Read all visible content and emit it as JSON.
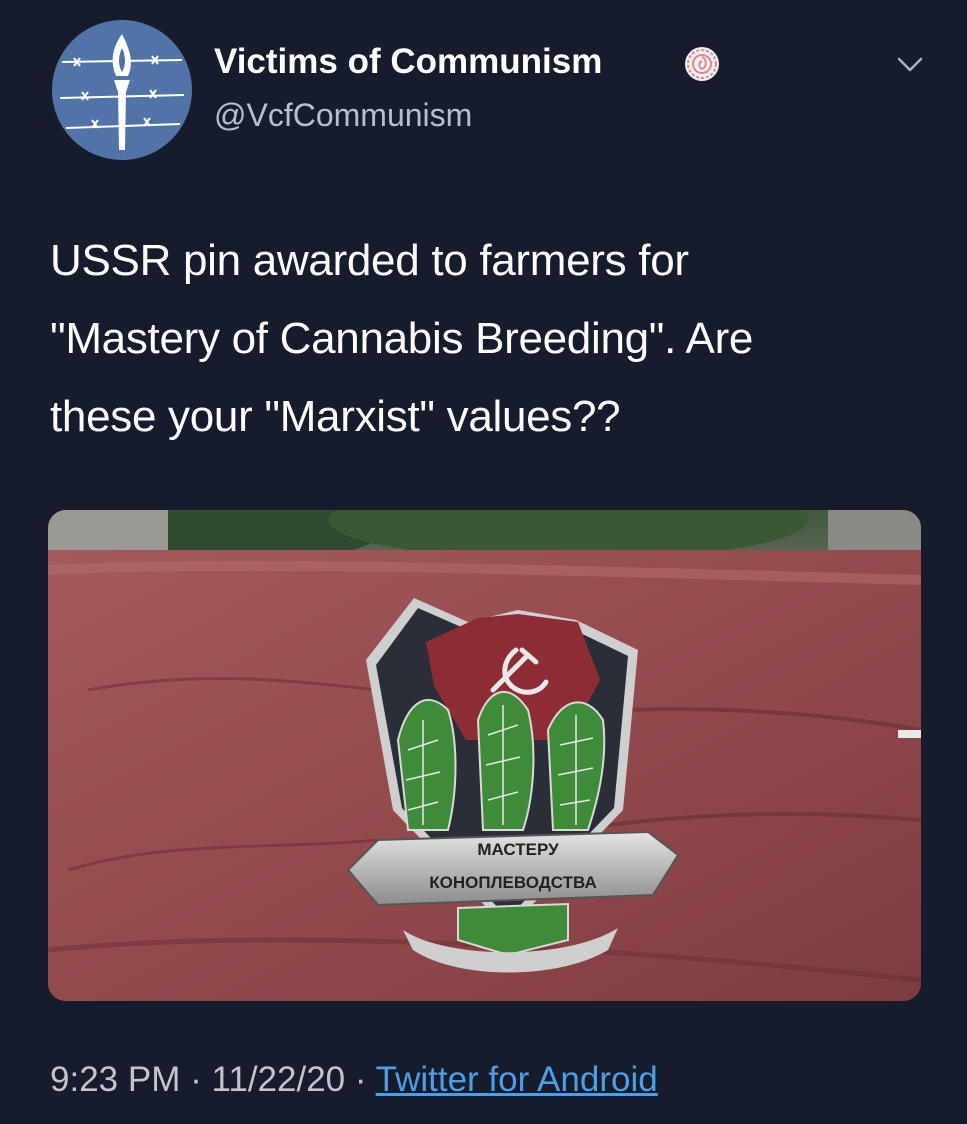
{
  "author": {
    "display_name": "Victims of Communism",
    "handle": "@VcfCommunism"
  },
  "tweet": {
    "text_lines": [
      "USSR pin awarded to farmers for",
      "\"Mastery of Cannabis Breeding\". Are",
      "these your \"Marxist\" values??"
    ]
  },
  "media": {
    "pin_text_line1": "МАСТЕРУ",
    "pin_text_line2": "КОНОПЛЕВОДСТВА"
  },
  "meta": {
    "time": "9:23 PM",
    "separator": "·",
    "date": "11/22/20",
    "source": "Twitter for Android"
  },
  "colors": {
    "background": "#161c2b",
    "link": "#4b9fe8",
    "handle": "#b8bfcc"
  },
  "icons": {
    "avatar": "torch-barbed-wire-logo",
    "badge": "verified-badge-icon",
    "menu": "chevron-down-icon"
  }
}
